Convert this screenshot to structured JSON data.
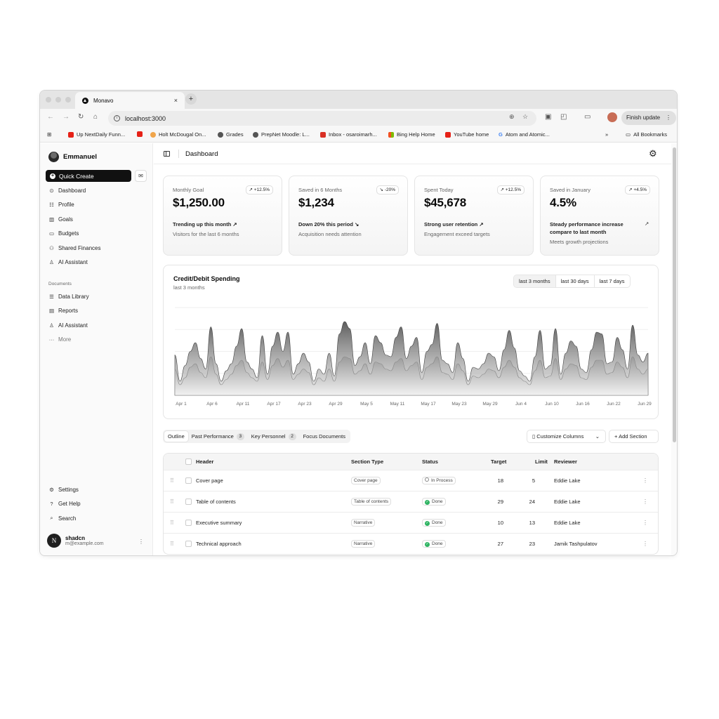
{
  "browser": {
    "tab_title": "Monavo",
    "tab_close": "×",
    "new_tab": "+",
    "url": "localhost:3000",
    "finish_update": "Finish update",
    "bookmarks": [
      {
        "label": "Up NextDaily Funn...",
        "color": "#e62117"
      },
      {
        "label": "",
        "color": "#e62117"
      },
      {
        "label": "Holt McDougal On...",
        "color": "#f0a54b"
      },
      {
        "label": "Grades",
        "color": "#555555"
      },
      {
        "label": "PrepNet Moodle: L...",
        "color": "#555555"
      },
      {
        "label": "Inbox - osaroimarh...",
        "color": "#d93025"
      },
      {
        "label": "Bing Help Home",
        "color": "#7fba00"
      },
      {
        "label": "YouTube home",
        "color": "#e62117"
      },
      {
        "label": "Atom and Atomic...",
        "color": "#4285f4"
      }
    ],
    "more_bookmarks": "»",
    "all_bookmarks": "All Bookmarks"
  },
  "sidebar": {
    "user_name": "Emmanuel",
    "quick_create": "Quick Create",
    "nav": [
      {
        "label": "Dashboard",
        "icon": "dashboard-icon",
        "glyph": "⊙"
      },
      {
        "label": "Profile",
        "icon": "profile-icon",
        "glyph": "☷"
      },
      {
        "label": "Goals",
        "icon": "goals-icon",
        "glyph": "▥"
      },
      {
        "label": "Budgets",
        "icon": "folder-icon",
        "glyph": "▭"
      },
      {
        "label": "Shared Finances",
        "icon": "users-icon",
        "glyph": "⚇"
      },
      {
        "label": "AI Assistant",
        "icon": "user-icon",
        "glyph": "♙"
      }
    ],
    "documents_label": "Documents",
    "documents": [
      {
        "label": "Data Library",
        "icon": "database-icon",
        "glyph": "☰"
      },
      {
        "label": "Reports",
        "icon": "reports-icon",
        "glyph": "▤"
      },
      {
        "label": "AI Assistant",
        "icon": "user-icon",
        "glyph": "♙"
      },
      {
        "label": "More",
        "icon": "more-icon",
        "glyph": "···"
      }
    ],
    "footer_nav": [
      {
        "label": "Settings",
        "icon": "settings-icon",
        "glyph": "⚙"
      },
      {
        "label": "Get Help",
        "icon": "help-icon",
        "glyph": "?"
      },
      {
        "label": "Search",
        "icon": "search-icon",
        "glyph": "⌕"
      }
    ],
    "account": {
      "initial": "N",
      "name": "shadcn",
      "email": "m@example.com"
    }
  },
  "header": {
    "title": "Dashboard"
  },
  "cards": [
    {
      "label": "Monthly Goal",
      "value": "$1,250.00",
      "badge": "+12.5%",
      "trend": "Trending up this month",
      "trend_icon": "↗",
      "sub": "Visitors for the last 6 months"
    },
    {
      "label": "Saved in 6 Months",
      "value": "$1,234",
      "badge": "-20%",
      "trend": "Down 20% this period",
      "trend_icon": "↘",
      "sub": "Acquisition needs attention"
    },
    {
      "label": "Spent Today",
      "value": "$45,678",
      "badge": "+12.5%",
      "trend": "Strong user retention",
      "trend_icon": "↗",
      "sub": "Engagement exceed targets"
    },
    {
      "label": "Saved in January",
      "value": "4.5%",
      "badge": "+4.5%",
      "trend": "Steady performance increase compare to last month",
      "trend_icon": "↗",
      "sub": "Meets growth projections"
    }
  ],
  "chart": {
    "title": "Credit/Debit Spending",
    "subtitle": "last 3 months",
    "ranges": [
      "last 3 months",
      "last 30 days",
      "last 7 days"
    ]
  },
  "chart_data": {
    "type": "area",
    "title": "Credit/Debit Spending",
    "x_ticks": [
      "Apr 1",
      "Apr 6",
      "Apr 11",
      "Apr 17",
      "Apr 23",
      "Apr 29",
      "May 5",
      "May 11",
      "May 17",
      "May 23",
      "May 29",
      "Jun 4",
      "Jun 10",
      "Jun 16",
      "Jun 22",
      "Jun 29"
    ],
    "ylim": [
      0,
      500
    ],
    "grid": true,
    "legend": "none",
    "series": [
      {
        "values": [
          230,
          80,
          170,
          250,
          300,
          210,
          150,
          390,
          180,
          80,
          140,
          180,
          280,
          380,
          190,
          150,
          100,
          340,
          120,
          280,
          360,
          250,
          360,
          120,
          180,
          240,
          190,
          80,
          150,
          120,
          240,
          110,
          350,
          420,
          380,
          170,
          220,
          300,
          180,
          340,
          300,
          230,
          220,
          330,
          390,
          210,
          280,
          330,
          130,
          250,
          290,
          410,
          200,
          180,
          130,
          300,
          210,
          80,
          160,
          150,
          180,
          240,
          220,
          140,
          260,
          370,
          270,
          140,
          110,
          80,
          220,
          370,
          150,
          170,
          380,
          120,
          240,
          310,
          280,
          150,
          130,
          260,
          360,
          350,
          180,
          190,
          330,
          260,
          150,
          400,
          230,
          190,
          240
        ]
      },
      {
        "values": [
          150,
          60,
          100,
          160,
          180,
          130,
          100,
          220,
          120,
          60,
          90,
          120,
          170,
          200,
          130,
          100,
          80,
          190,
          90,
          170,
          210,
          160,
          200,
          90,
          120,
          150,
          130,
          60,
          100,
          80,
          150,
          80,
          190,
          220,
          210,
          120,
          140,
          180,
          120,
          190,
          180,
          150,
          140,
          190,
          210,
          140,
          170,
          190,
          90,
          160,
          180,
          220,
          130,
          120,
          90,
          180,
          140,
          60,
          110,
          100,
          120,
          150,
          140,
          100,
          160,
          200,
          160,
          100,
          80,
          60,
          140,
          200,
          100,
          110,
          210,
          90,
          150,
          180,
          170,
          100,
          90,
          160,
          200,
          200,
          120,
          130,
          190,
          160,
          100,
          220,
          150,
          120,
          150
        ]
      }
    ]
  },
  "table_tabs": [
    {
      "label": "Outline",
      "count": ""
    },
    {
      "label": "Past Performance",
      "count": "3"
    },
    {
      "label": "Key Personnel",
      "count": "2"
    },
    {
      "label": "Focus Documents",
      "count": ""
    }
  ],
  "customize_columns": "Customize Columns",
  "add_section": "Add Section",
  "table": {
    "headers": [
      "Header",
      "Section Type",
      "Status",
      "Target",
      "Limit",
      "Reviewer"
    ],
    "rows": [
      {
        "header": "Cover page",
        "type": "Cover page",
        "status": "In Process",
        "target": "18",
        "limit": "5",
        "reviewer": "Eddie Lake"
      },
      {
        "header": "Table of contents",
        "type": "Table of contents",
        "status": "Done",
        "target": "29",
        "limit": "24",
        "reviewer": "Eddie Lake"
      },
      {
        "header": "Executive summary",
        "type": "Narrative",
        "status": "Done",
        "target": "10",
        "limit": "13",
        "reviewer": "Eddie Lake"
      },
      {
        "header": "Technical approach",
        "type": "Narrative",
        "status": "Done",
        "target": "27",
        "limit": "23",
        "reviewer": "Jamik Tashpulatov"
      }
    ]
  }
}
